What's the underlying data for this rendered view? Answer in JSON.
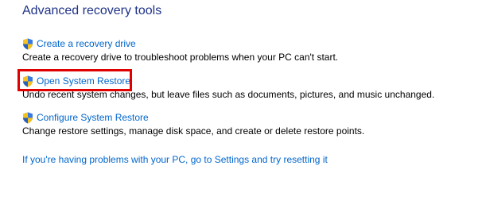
{
  "section": {
    "title": "Advanced recovery tools"
  },
  "tools": [
    {
      "label": "Create a recovery drive",
      "description": "Create a recovery drive to troubleshoot problems when your PC can't start.",
      "icon": "uac-shield-icon"
    },
    {
      "label": "Open System Restore",
      "description": "Undo recent system changes, but leave files such as documents, pictures, and music unchanged.",
      "icon": "uac-shield-icon"
    },
    {
      "label": "Configure System Restore",
      "description": "Change restore settings, manage disk space, and create or delete restore points.",
      "icon": "uac-shield-icon"
    }
  ],
  "footer": {
    "link": "If you're having problems with your PC, go to Settings and try resetting it"
  },
  "colors": {
    "title": "#1e3287",
    "link": "#0066cc",
    "highlight": "#e00000"
  }
}
